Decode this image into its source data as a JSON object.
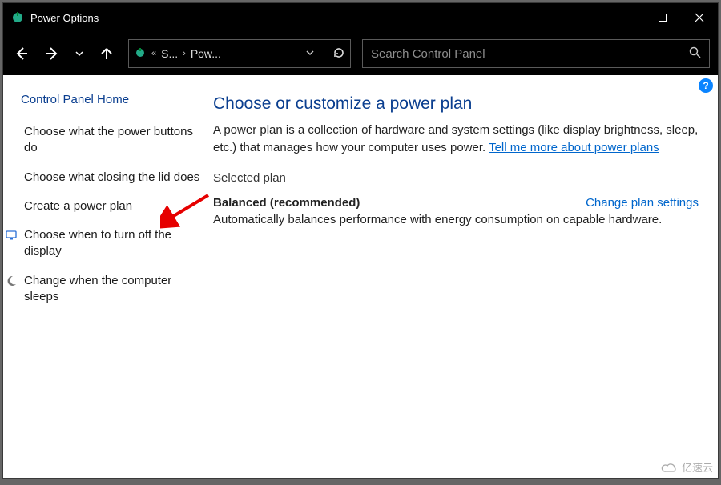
{
  "window": {
    "title": "Power Options"
  },
  "nav": {
    "breadcrumb_root": "S...",
    "breadcrumb_current": "Pow...",
    "search_placeholder": "Search Control Panel"
  },
  "sidebar": {
    "home": "Control Panel Home",
    "items": [
      {
        "label": "Choose what the power buttons do",
        "icon": ""
      },
      {
        "label": "Choose what closing the lid does",
        "icon": ""
      },
      {
        "label": "Create a power plan",
        "icon": ""
      },
      {
        "label": "Choose when to turn off the display",
        "icon": "monitor"
      },
      {
        "label": "Change when the computer sleeps",
        "icon": "moon"
      }
    ]
  },
  "main": {
    "heading": "Choose or customize a power plan",
    "description_pre": "A power plan is a collection of hardware and system settings (like display brightness, sleep, etc.) that manages how your computer uses power. ",
    "description_link": "Tell me more about power plans",
    "section_label": "Selected plan",
    "plan_name": "Balanced (recommended)",
    "change_link": "Change plan settings",
    "plan_desc": "Automatically balances performance with energy consumption on capable hardware."
  },
  "help_badge": "?",
  "watermark": "亿速云"
}
